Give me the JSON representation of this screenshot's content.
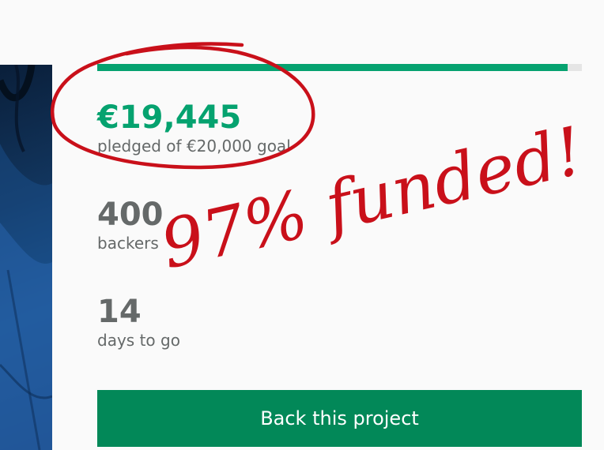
{
  "funding": {
    "progress_fraction": 0.97,
    "pledged_amount": "€19,445",
    "pledged_label": "pledged of €20,000 goal",
    "backers_count": "400",
    "backers_label": "backers",
    "days_count": "14",
    "days_label": "days to go"
  },
  "actions": {
    "back_button_label": "Back this project"
  },
  "annotation": {
    "text": "97% funded!",
    "color": "#c9101a"
  },
  "colors": {
    "accent": "#05a26f",
    "button": "#028858",
    "muted_text": "#656969"
  }
}
